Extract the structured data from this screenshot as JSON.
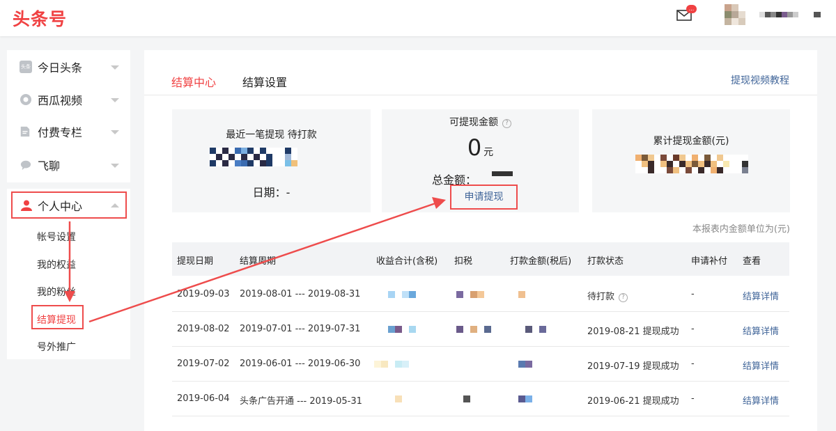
{
  "header": {
    "logo": "头条号",
    "mail_badge": "..."
  },
  "sidebar": {
    "items": [
      {
        "label": "今日头条",
        "icon": "toutiao-icon",
        "icon_text": "头条"
      },
      {
        "label": "西瓜视频",
        "icon": "xigua-icon"
      },
      {
        "label": "付费专栏",
        "icon": "column-icon"
      },
      {
        "label": "飞聊",
        "icon": "chat-icon"
      }
    ],
    "personal": {
      "label": "个人中心",
      "icon": "user-icon",
      "sub_items": [
        "帐号设置",
        "我的权益",
        "我的粉丝",
        "结算提现",
        "号外推广"
      ]
    }
  },
  "main": {
    "tabs": [
      "结算中心",
      "结算设置"
    ],
    "tutorial_link": "提现视频教程",
    "cards": {
      "recent": {
        "title": "最近一笔提现 待打款",
        "date_label": "日期：-"
      },
      "available": {
        "title": "可提现金额",
        "amount": "0",
        "unit": "元",
        "total_label": "总金额：",
        "button": "申请提现"
      },
      "cumulative": {
        "title": "累计提现金额(元)"
      }
    },
    "unit_note": "本报表内金额单位为(元)",
    "table": {
      "headers": [
        "提现日期",
        "结算周期",
        "收益合计(含税)",
        "扣税",
        "打款金额(税后)",
        "打款状态",
        "申请补付",
        "查看"
      ],
      "rows": [
        {
          "date": "2019-09-03",
          "period": "2019-08-01 --- 2019-08-31",
          "status": "待打款",
          "supplement": "-",
          "action": "结算详情"
        },
        {
          "date": "2019-08-02",
          "period": "2019-07-01 --- 2019-07-31",
          "status": "2019-08-21 提现成功",
          "supplement": "-",
          "action": "结算详情"
        },
        {
          "date": "2019-07-02",
          "period": "2019-06-01 --- 2019-06-30",
          "status": "2019-07-19 提现成功",
          "supplement": "-",
          "action": "结算详情"
        },
        {
          "date": "2019-06-04",
          "period": "头条广告开通 --- 2019-05-31",
          "status": "2019-06-21 提现成功",
          "supplement": "-",
          "action": "结算详情"
        }
      ]
    }
  },
  "colors": {
    "accent": "#f04142",
    "link": "#406599",
    "annotation": "#ee4c4c"
  }
}
